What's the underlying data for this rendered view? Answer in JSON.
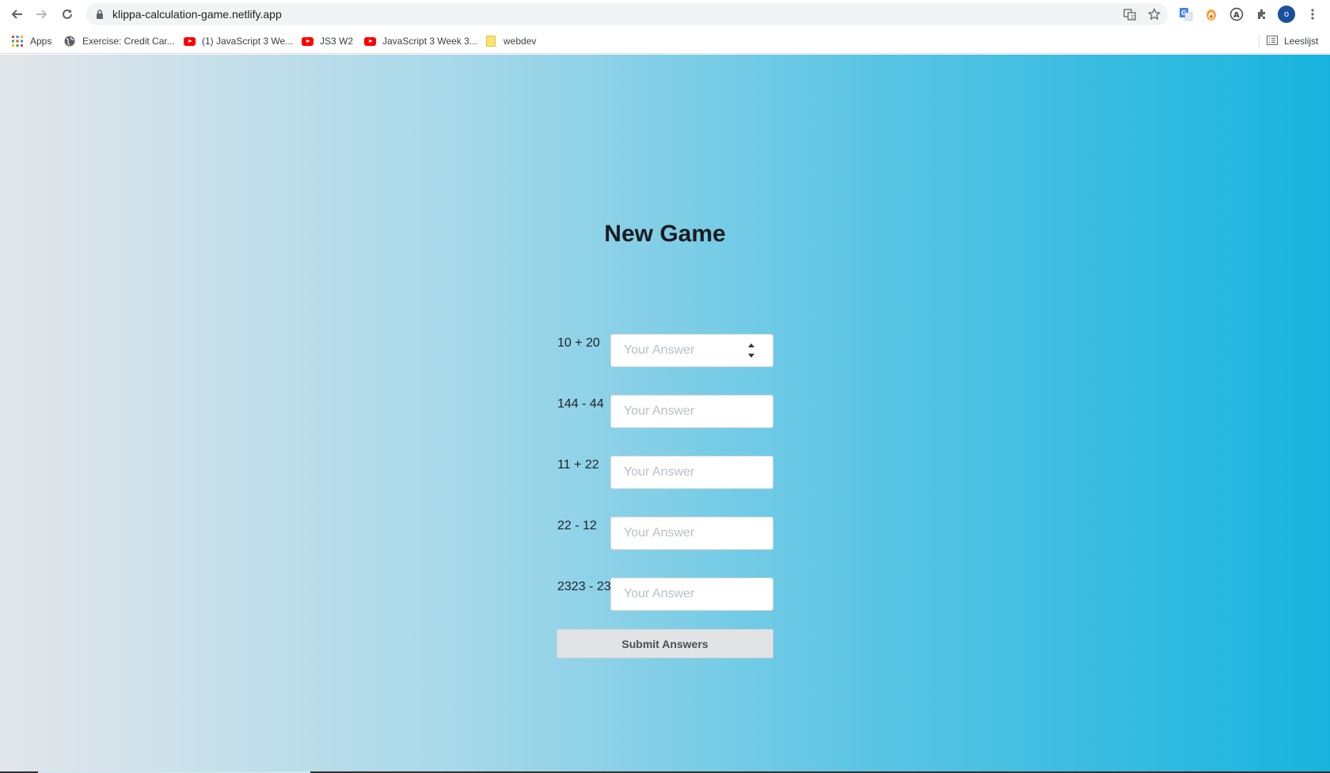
{
  "browser": {
    "url": "klippa-calculation-game.netlify.app",
    "bookmarks": [
      {
        "label": "Apps",
        "icon": "apps-grid-icon"
      },
      {
        "label": "Exercise: Credit Car...",
        "icon": "globe-icon"
      },
      {
        "label": "(1) JavaScript 3 We...",
        "icon": "youtube-icon"
      },
      {
        "label": "JS3 W2",
        "icon": "youtube-icon"
      },
      {
        "label": "JavaScript 3 Week 3...",
        "icon": "youtube-icon"
      },
      {
        "label": "webdev",
        "icon": "folder-icon"
      }
    ],
    "reading_list": "Leeslijst",
    "profile_initial": "o"
  },
  "game": {
    "title": "New Game",
    "placeholder": "Your Answer",
    "questions": [
      {
        "text": "10 + 20"
      },
      {
        "text": "144 - 44"
      },
      {
        "text": "11 + 22"
      },
      {
        "text": "22 - 12"
      },
      {
        "text": "2323 - 23"
      }
    ],
    "submit_label": "Submit Answers"
  },
  "colors": {
    "gradient_start": "#e3e6ea",
    "gradient_end": "#18b4de",
    "title": "#1a1d21"
  }
}
